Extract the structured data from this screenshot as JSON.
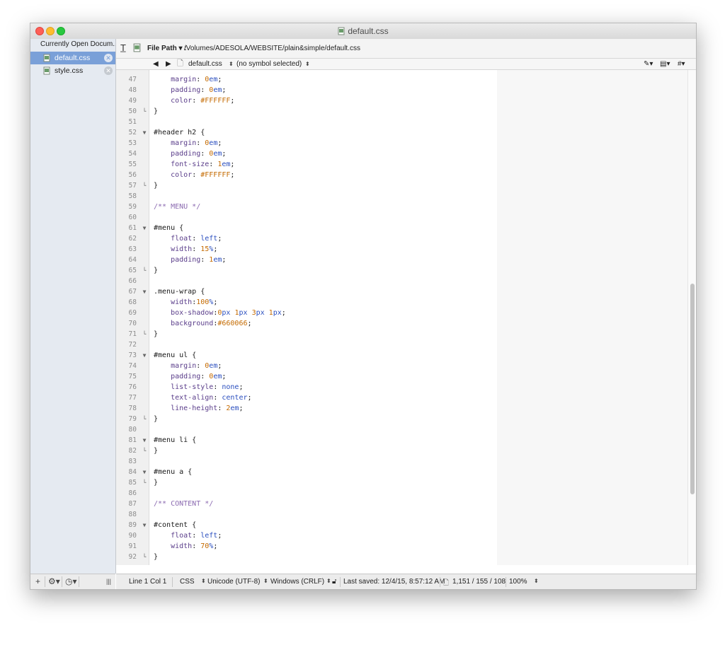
{
  "window": {
    "title": "default.css"
  },
  "sidebar": {
    "header": "Currently Open Docum...",
    "items": [
      {
        "label": "default.css",
        "selected": true
      },
      {
        "label": "style.css",
        "selected": false
      }
    ]
  },
  "toolbar": {
    "file_path_label": "File Path ▾ :",
    "file_path": "/Volumes/ADESOLA/WEBSITE/plain&simple/default.css"
  },
  "navbar": {
    "back": "◀",
    "forward": "▶",
    "file": "default.css",
    "symbol": "(no symbol selected)"
  },
  "editor": {
    "lines": [
      {
        "n": "47",
        "fold": "",
        "text": "    margin: 0em;"
      },
      {
        "n": "48",
        "fold": "",
        "text": "    padding: 0em;"
      },
      {
        "n": "49",
        "fold": "",
        "text": "    color: #FFFFFF;"
      },
      {
        "n": "50",
        "fold": "└",
        "text": "}"
      },
      {
        "n": "51",
        "fold": "",
        "text": ""
      },
      {
        "n": "52",
        "fold": "▼",
        "text": "#header h2 {"
      },
      {
        "n": "53",
        "fold": "",
        "text": "    margin: 0em;"
      },
      {
        "n": "54",
        "fold": "",
        "text": "    padding: 0em;"
      },
      {
        "n": "55",
        "fold": "",
        "text": "    font-size: 1em;"
      },
      {
        "n": "56",
        "fold": "",
        "text": "    color: #FFFFFF;"
      },
      {
        "n": "57",
        "fold": "└",
        "text": "}"
      },
      {
        "n": "58",
        "fold": "",
        "text": ""
      },
      {
        "n": "59",
        "fold": "",
        "text": "/** MENU */"
      },
      {
        "n": "60",
        "fold": "",
        "text": ""
      },
      {
        "n": "61",
        "fold": "▼",
        "text": "#menu {"
      },
      {
        "n": "62",
        "fold": "",
        "text": "    float: left;"
      },
      {
        "n": "63",
        "fold": "",
        "text": "    width: 15%;"
      },
      {
        "n": "64",
        "fold": "",
        "text": "    padding: 1em;"
      },
      {
        "n": "65",
        "fold": "└",
        "text": "}"
      },
      {
        "n": "66",
        "fold": "",
        "text": ""
      },
      {
        "n": "67",
        "fold": "▼",
        "text": ".menu-wrap {"
      },
      {
        "n": "68",
        "fold": "",
        "text": "    width:100%;"
      },
      {
        "n": "69",
        "fold": "",
        "text": "    box-shadow:0px 1px 3px 1px;"
      },
      {
        "n": "70",
        "fold": "",
        "text": "    background:#660066;"
      },
      {
        "n": "71",
        "fold": "└",
        "text": "}"
      },
      {
        "n": "72",
        "fold": "",
        "text": ""
      },
      {
        "n": "73",
        "fold": "▼",
        "text": "#menu ul {"
      },
      {
        "n": "74",
        "fold": "",
        "text": "    margin: 0em;"
      },
      {
        "n": "75",
        "fold": "",
        "text": "    padding: 0em;"
      },
      {
        "n": "76",
        "fold": "",
        "text": "    list-style: none;"
      },
      {
        "n": "77",
        "fold": "",
        "text": "    text-align: center;"
      },
      {
        "n": "78",
        "fold": "",
        "text": "    line-height: 2em;"
      },
      {
        "n": "79",
        "fold": "└",
        "text": "}"
      },
      {
        "n": "80",
        "fold": "",
        "text": ""
      },
      {
        "n": "81",
        "fold": "▼",
        "text": "#menu li {"
      },
      {
        "n": "82",
        "fold": "└",
        "text": "}"
      },
      {
        "n": "83",
        "fold": "",
        "text": ""
      },
      {
        "n": "84",
        "fold": "▼",
        "text": "#menu a {"
      },
      {
        "n": "85",
        "fold": "└",
        "text": "}"
      },
      {
        "n": "86",
        "fold": "",
        "text": ""
      },
      {
        "n": "87",
        "fold": "",
        "text": "/** CONTENT */"
      },
      {
        "n": "88",
        "fold": "",
        "text": ""
      },
      {
        "n": "89",
        "fold": "▼",
        "text": "#content {"
      },
      {
        "n": "90",
        "fold": "",
        "text": "    float: left;"
      },
      {
        "n": "91",
        "fold": "",
        "text": "    width: 70%;"
      },
      {
        "n": "92",
        "fold": "└",
        "text": "}"
      }
    ]
  },
  "statusbar": {
    "position": "Line 1 Col 1",
    "language": "CSS",
    "encoding": "Unicode (UTF-8)",
    "line_endings": "Windows (CRLF)",
    "last_saved": "Last saved: 12/4/15, 8:57:12 AM",
    "counts": "1,151 / 155 / 108",
    "zoom": "100%"
  },
  "colors": {
    "sidebar_bg": "#e5eaf1",
    "selection": "#7aa0d8",
    "comment": "#8c6bb1",
    "number": "#c46a00",
    "keyword": "#2b4fbf"
  }
}
